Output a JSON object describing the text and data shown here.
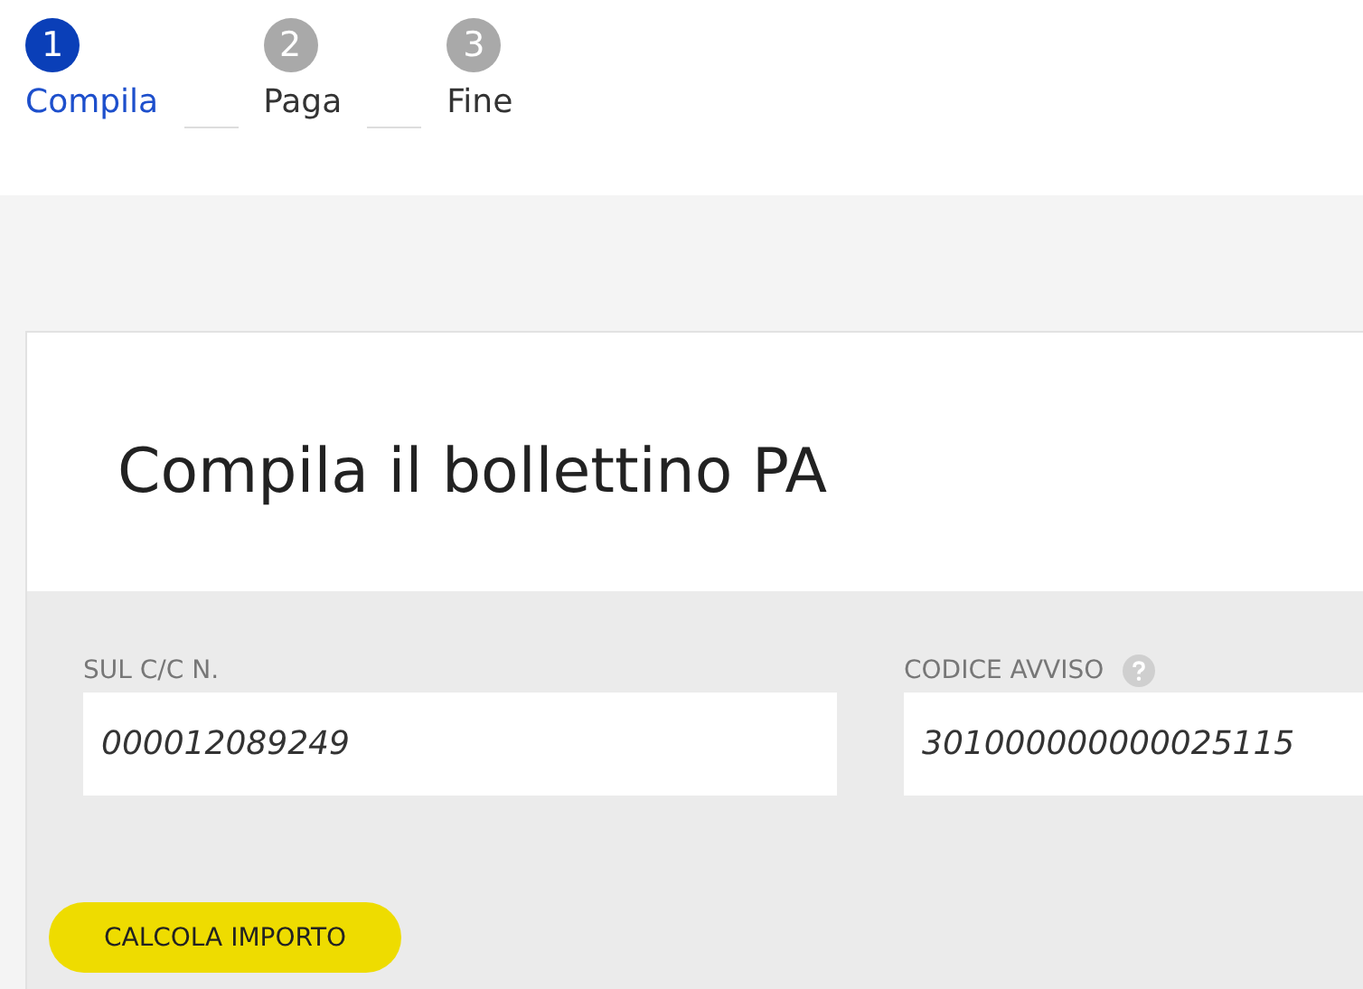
{
  "steps": [
    {
      "number": "1",
      "label": "Compila",
      "selected": true
    },
    {
      "number": "2",
      "label": "Paga",
      "selected": false
    },
    {
      "number": "3",
      "label": "Fine",
      "selected": false
    }
  ],
  "form": {
    "title": "Compila il bollettino PA",
    "fields": [
      {
        "label": "SUL C/C N.",
        "value": "000012089249",
        "help": false
      },
      {
        "label": "CODICE AVVISO",
        "value": "301000000000025115",
        "help": true
      }
    ],
    "button": "CALCOLA IMPORTO"
  }
}
